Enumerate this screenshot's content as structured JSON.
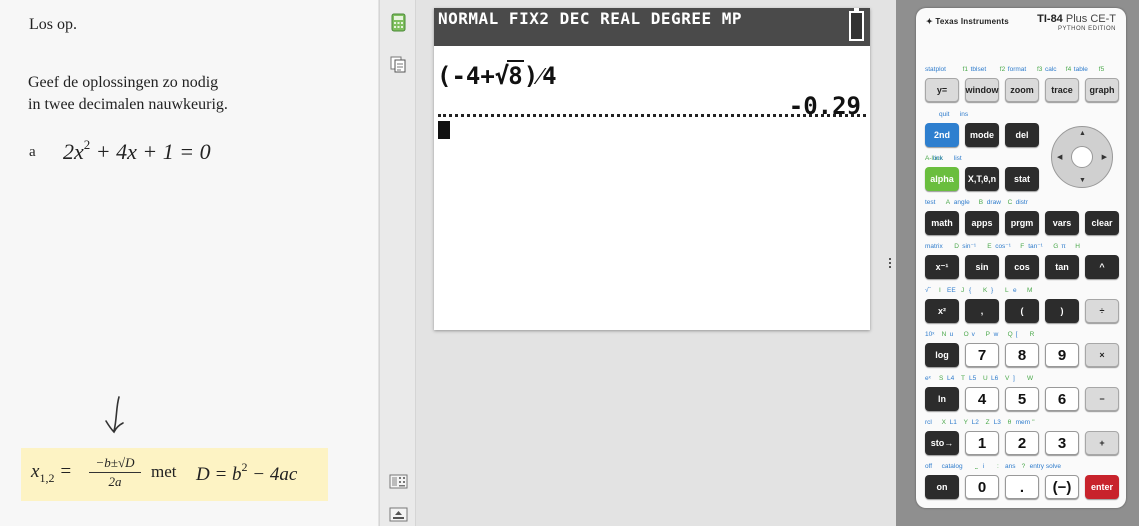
{
  "worksheet": {
    "title": "Los op.",
    "instruction_line1": "Geef de oplossingen zo nodig",
    "instruction_line2": "in twee decimalen nauwkeurig.",
    "question_label": "a",
    "equation_lhs": "2x",
    "equation_exp": "2",
    "equation_rest": " + 4x + 1 = 0",
    "formula": {
      "lhs": "x",
      "lhs_sub": "1,2",
      "equals": " =",
      "numerator": "−b±√D",
      "denominator": "2a",
      "met": "met",
      "d_expr": "D = b",
      "d_exp": "2",
      "d_rest": " − 4ac",
      "highlight_color": "#fdf3c4"
    }
  },
  "toolbar": {
    "icons": [
      "calculator-icon",
      "copy-icon",
      "keypad-layout-icon",
      "collapse-icon"
    ]
  },
  "screen": {
    "status": "NORMAL FIX2 DEC REAL DEGREE MP",
    "expression_pre": "(-4+",
    "expression_sqrt": "8",
    "expression_post": ")⁄4",
    "result": "-0.29",
    "status_bg": "#4a4a4a",
    "battery_color": "#38c238"
  },
  "calculator": {
    "brand": "Texas Instruments",
    "model": "TI-84",
    "model_suffix": "Plus CE-T",
    "edition": "PYTHON EDITION",
    "rows": [
      {
        "labels": [
          [
            "statplot",
            "b"
          ],
          [
            "f1",
            "g"
          ],
          [
            "tblset",
            "b"
          ],
          [
            "f2",
            "g"
          ],
          [
            "format",
            "b"
          ],
          [
            "f3",
            "g"
          ],
          [
            "calc",
            "b"
          ],
          [
            "f4",
            "g"
          ],
          [
            "table",
            "b"
          ],
          [
            "f5",
            "g"
          ]
        ],
        "keys": [
          [
            "y=",
            "lg"
          ],
          [
            "window",
            "lg"
          ],
          [
            "zoom",
            "lg"
          ],
          [
            "trace",
            "lg"
          ],
          [
            "graph",
            "lg"
          ]
        ]
      },
      {
        "labels": [
          [
            "",
            "b"
          ],
          [
            "quit",
            "b"
          ],
          [
            "ins",
            "b"
          ]
        ],
        "keys": [
          [
            "2nd",
            "bl"
          ],
          [
            "mode",
            "dk"
          ],
          [
            "del",
            "dk"
          ]
        ]
      },
      {
        "labels": [
          [
            "A-lock",
            "g"
          ],
          [
            "link",
            "b"
          ],
          [
            "list",
            "b"
          ]
        ],
        "keys": [
          [
            "alpha",
            "gr"
          ],
          [
            "X,T,θ,n",
            "dk"
          ],
          [
            "stat",
            "dk"
          ]
        ]
      },
      {
        "labels": [
          [
            "test",
            "b"
          ],
          [
            "A",
            "g"
          ],
          [
            "angle",
            "b"
          ],
          [
            "B",
            "g"
          ],
          [
            "draw",
            "b"
          ],
          [
            "C",
            "g"
          ],
          [
            "distr",
            "b"
          ]
        ],
        "keys": [
          [
            "math",
            "dk"
          ],
          [
            "apps",
            "dk"
          ],
          [
            "prgm",
            "dk"
          ],
          [
            "vars",
            "dk"
          ],
          [
            "clear",
            "dk"
          ]
        ]
      },
      {
        "labels": [
          [
            "matrix",
            "b"
          ],
          [
            "D",
            "g"
          ],
          [
            "sin⁻¹",
            "b"
          ],
          [
            "E",
            "g"
          ],
          [
            "cos⁻¹",
            "b"
          ],
          [
            "F",
            "g"
          ],
          [
            "tan⁻¹",
            "b"
          ],
          [
            "G",
            "g"
          ],
          [
            "π",
            "b"
          ],
          [
            "H",
            "g"
          ]
        ],
        "keys": [
          [
            "x⁻¹",
            "dk"
          ],
          [
            "sin",
            "dk"
          ],
          [
            "cos",
            "dk"
          ],
          [
            "tan",
            "dk"
          ],
          [
            "^",
            "dk"
          ]
        ]
      },
      {
        "labels": [
          [
            "√‾",
            "b"
          ],
          [
            "I",
            "g"
          ],
          [
            "EE",
            "b"
          ],
          [
            "J",
            "g"
          ],
          [
            "{",
            "b"
          ],
          [
            "K",
            "g"
          ],
          [
            "}",
            "b"
          ],
          [
            "L",
            "g"
          ],
          [
            "e",
            "b"
          ],
          [
            "M",
            "g"
          ]
        ],
        "keys": [
          [
            "x²",
            "dk"
          ],
          [
            ",",
            "dk"
          ],
          [
            "(",
            "dk"
          ],
          [
            ")",
            "dk"
          ],
          [
            "÷",
            "lg"
          ]
        ]
      },
      {
        "labels": [
          [
            "10ˣ",
            "b"
          ],
          [
            "N",
            "g"
          ],
          [
            "u",
            "b"
          ],
          [
            "O",
            "g"
          ],
          [
            "v",
            "b"
          ],
          [
            "P",
            "g"
          ],
          [
            "w",
            "b"
          ],
          [
            "Q",
            "g"
          ],
          [
            "[",
            "b"
          ],
          [
            "R",
            "g"
          ]
        ],
        "keys": [
          [
            "log",
            "dk"
          ],
          [
            "7",
            "wt"
          ],
          [
            "8",
            "wt"
          ],
          [
            "9",
            "wt"
          ],
          [
            "×",
            "lg"
          ]
        ]
      },
      {
        "labels": [
          [
            "eˣ",
            "b"
          ],
          [
            "S",
            "g"
          ],
          [
            "L4",
            "b"
          ],
          [
            "T",
            "g"
          ],
          [
            "L5",
            "b"
          ],
          [
            "U",
            "g"
          ],
          [
            "L6",
            "b"
          ],
          [
            "V",
            "g"
          ],
          [
            "]",
            "b"
          ],
          [
            "W",
            "g"
          ]
        ],
        "keys": [
          [
            "ln",
            "dk"
          ],
          [
            "4",
            "wt"
          ],
          [
            "5",
            "wt"
          ],
          [
            "6",
            "wt"
          ],
          [
            "−",
            "lg"
          ]
        ]
      },
      {
        "labels": [
          [
            "rcl",
            "b"
          ],
          [
            "X",
            "g"
          ],
          [
            "L1",
            "b"
          ],
          [
            "Y",
            "g"
          ],
          [
            "L2",
            "b"
          ],
          [
            "Z",
            "g"
          ],
          [
            "L3",
            "b"
          ],
          [
            "θ",
            "g"
          ],
          [
            "mem",
            "b"
          ],
          [
            "\"",
            "g"
          ]
        ],
        "keys": [
          [
            "sto→",
            "dk"
          ],
          [
            "1",
            "wt"
          ],
          [
            "2",
            "wt"
          ],
          [
            "3",
            "wt"
          ],
          [
            "+",
            "lg"
          ]
        ]
      },
      {
        "labels": [
          [
            "off",
            "b"
          ],
          [
            "catalog",
            "b"
          ],
          [
            "⎵",
            "g"
          ],
          [
            "i",
            "b"
          ],
          [
            ":",
            "g"
          ],
          [
            "ans",
            "b"
          ],
          [
            "?",
            "g"
          ],
          [
            "entry solve",
            "b"
          ]
        ],
        "keys": [
          [
            "on",
            "dk"
          ],
          [
            "0",
            "wt"
          ],
          [
            ".",
            "wt"
          ],
          [
            "(−)",
            "wt"
          ],
          [
            "enter",
            "rd"
          ]
        ]
      }
    ]
  }
}
